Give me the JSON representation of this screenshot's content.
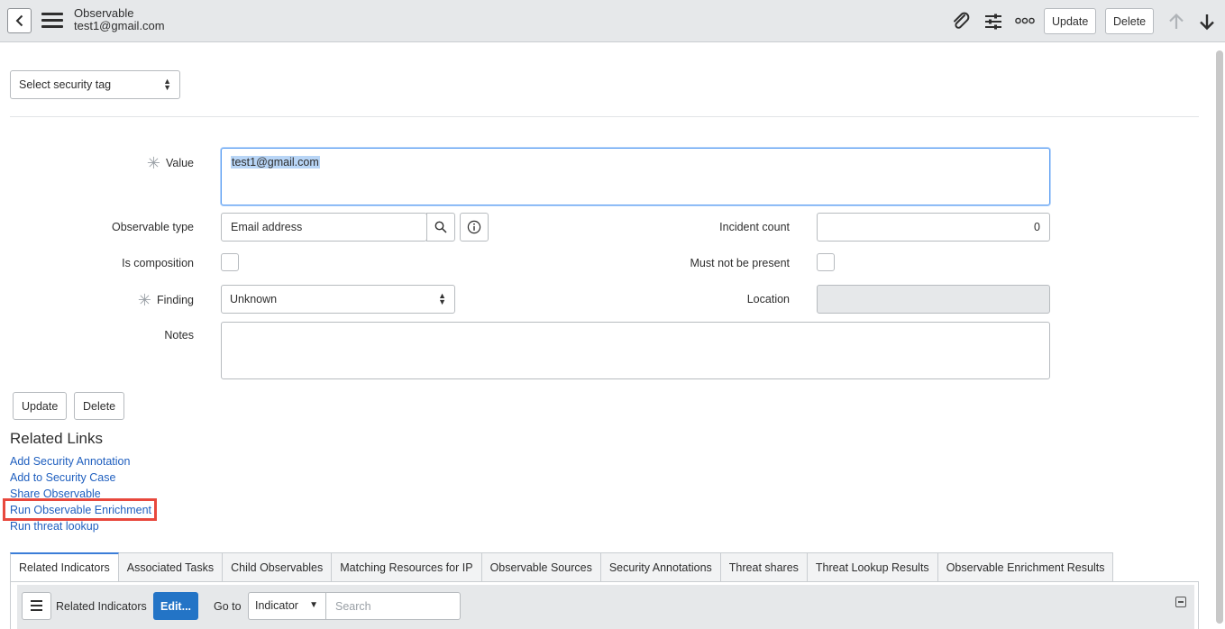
{
  "header": {
    "title": "Observable",
    "subtitle": "test1@gmail.com",
    "update_label": "Update",
    "delete_label": "Delete",
    "more_icon_text": "ooo"
  },
  "security_tag": {
    "selected": "Select security tag"
  },
  "form": {
    "value": {
      "label": "Value",
      "text": "test1@gmail.com",
      "required": true
    },
    "observable_type": {
      "label": "Observable type",
      "value": "Email address"
    },
    "incident_count": {
      "label": "Incident count",
      "value": "0"
    },
    "is_composition": {
      "label": "Is composition",
      "checked": false
    },
    "must_not_be_present": {
      "label": "Must not be present",
      "checked": false
    },
    "finding": {
      "label": "Finding",
      "value": "Unknown",
      "required": true
    },
    "location": {
      "label": "Location",
      "value": ""
    },
    "notes": {
      "label": "Notes",
      "value": ""
    }
  },
  "buttons": {
    "update": "Update",
    "delete": "Delete"
  },
  "related_links": {
    "title": "Related Links",
    "items": [
      "Add Security Annotation",
      "Add to Security Case",
      "Share Observable",
      "Run Observable Enrichment",
      "Run threat lookup"
    ],
    "highlighted_index": 3
  },
  "tabs": [
    "Related Indicators",
    "Associated Tasks",
    "Child Observables",
    "Matching Resources for IP",
    "Observable Sources",
    "Security Annotations",
    "Threat shares",
    "Threat Lookup Results",
    "Observable Enrichment Results"
  ],
  "list": {
    "title": "Related Indicators",
    "edit_label": "Edit...",
    "goto_label": "Go to",
    "goto_selected": "Indicator",
    "search_placeholder": "Search"
  },
  "colors": {
    "header_bg": "#e6e8ea",
    "link": "#1f5fbf",
    "primary_button": "#2374c6",
    "highlight_border": "#e8483d",
    "focus_border": "#5d9ff2"
  }
}
